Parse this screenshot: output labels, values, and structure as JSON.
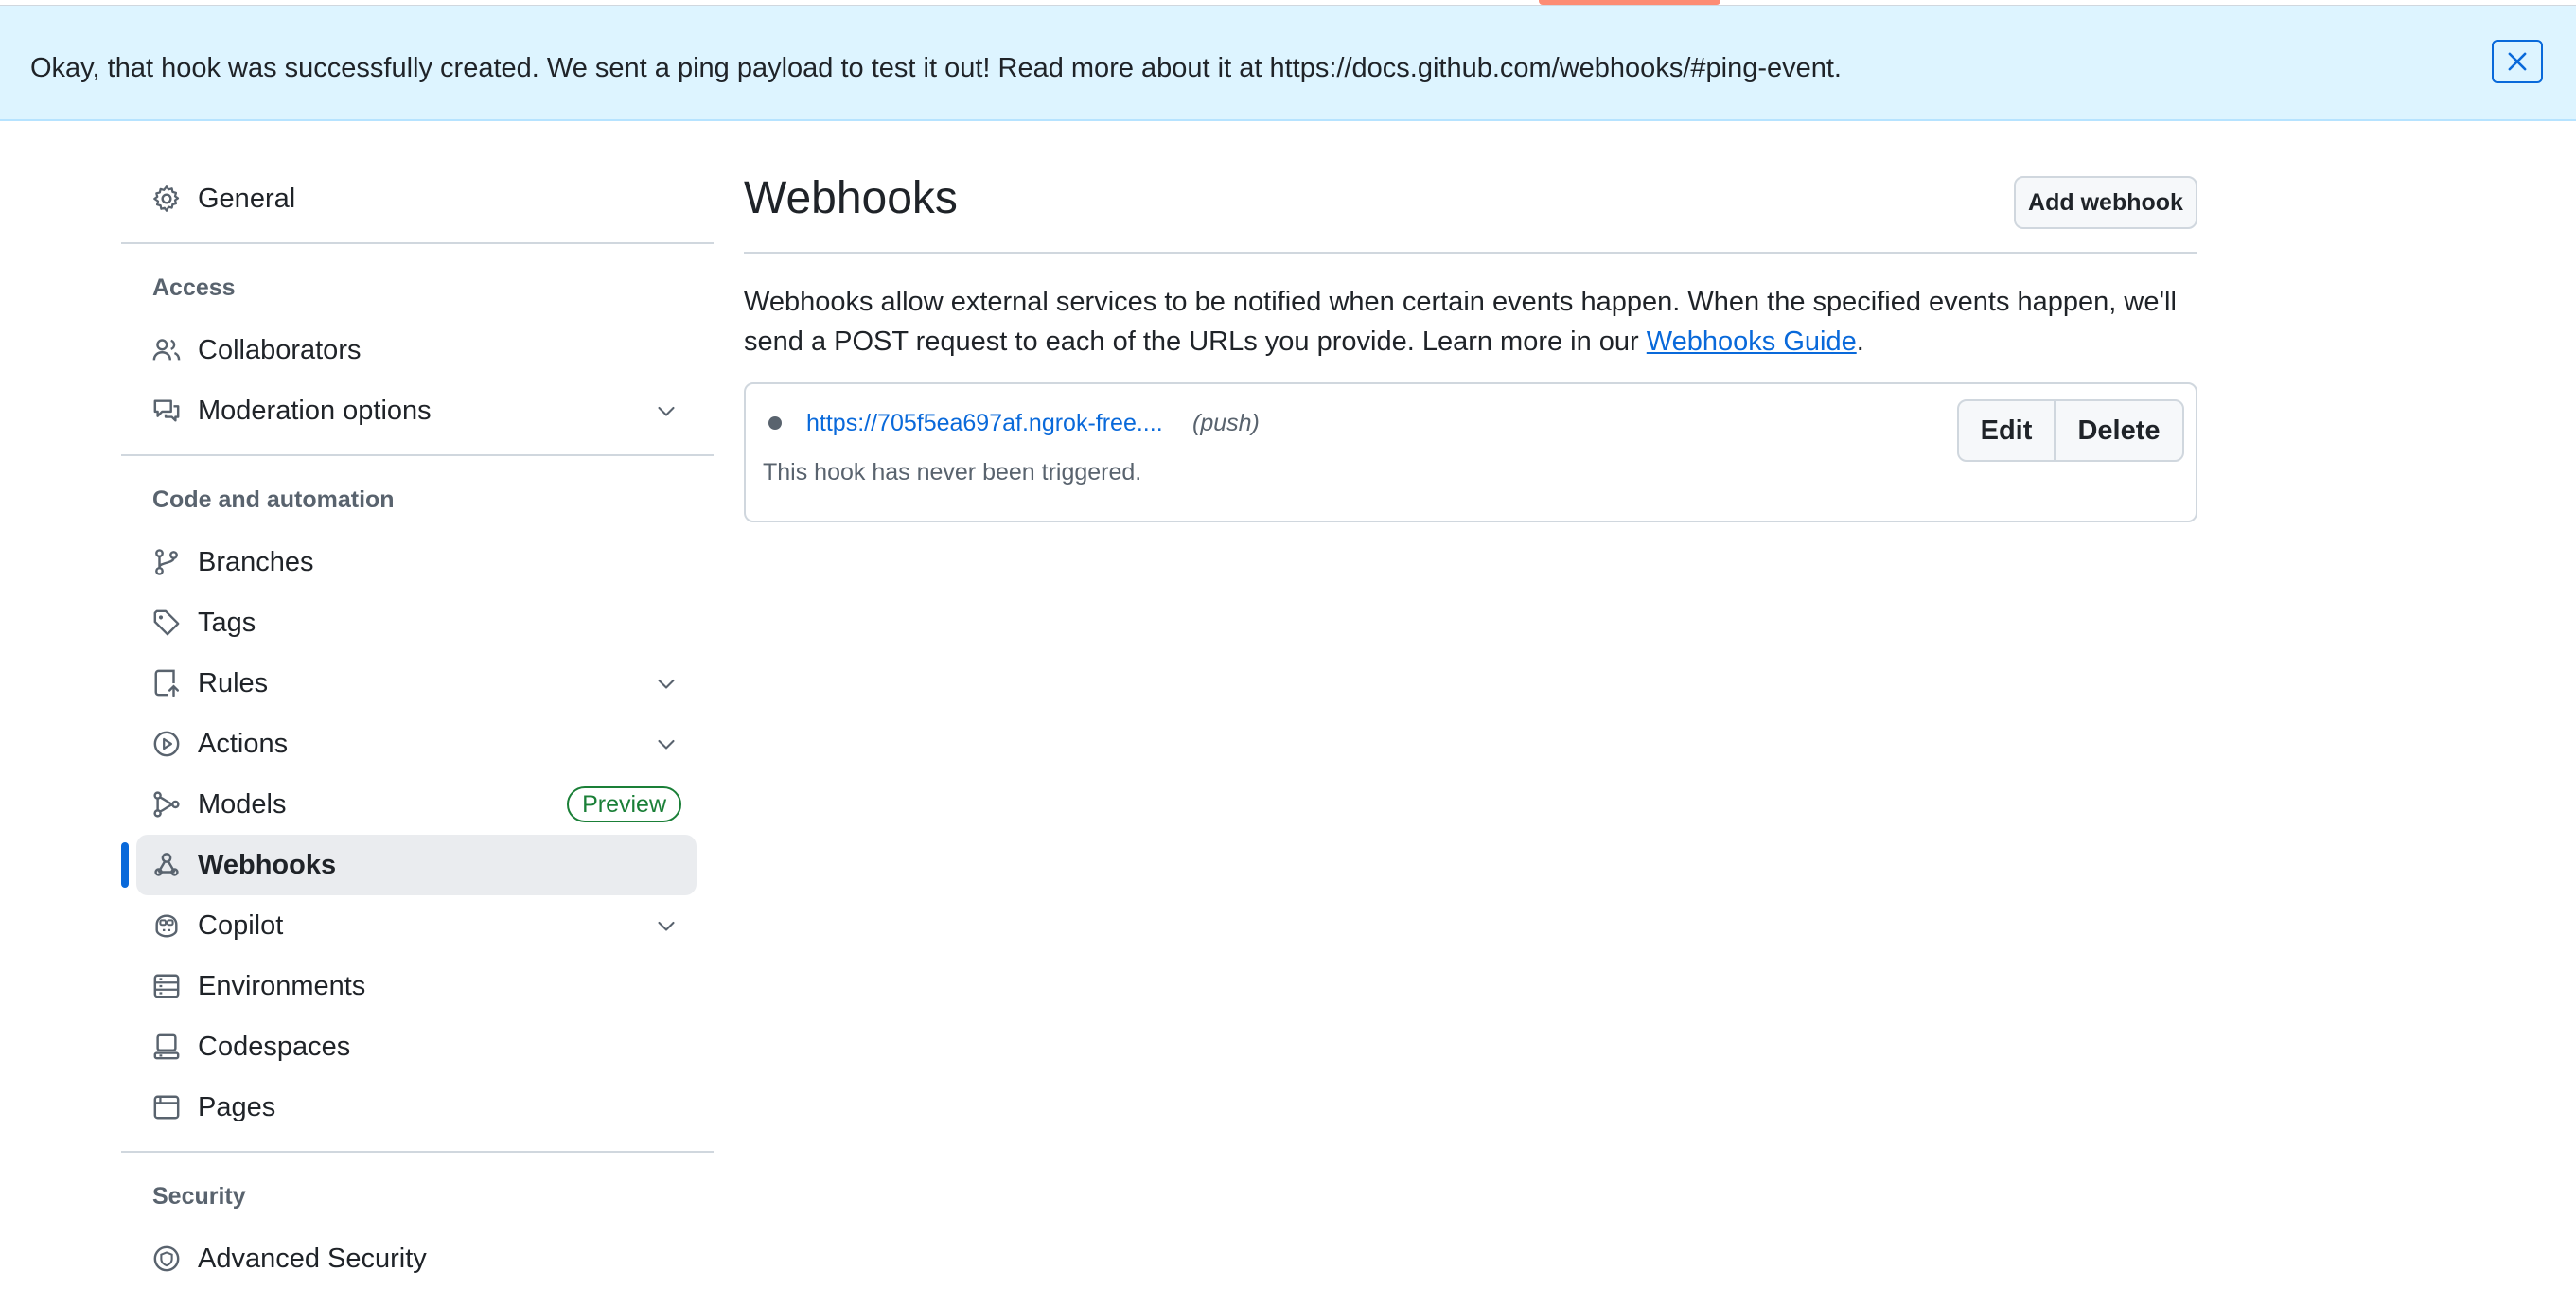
{
  "flash": {
    "message": "Okay, that hook was successfully created. We sent a ping payload to test it out! Read more about it at https://docs.github.com/webhooks/#ping-event."
  },
  "sidebar": {
    "general": "General",
    "sections": {
      "access": "Access",
      "code_automation": "Code and automation",
      "security": "Security"
    },
    "items": {
      "collaborators": "Collaborators",
      "moderation": "Moderation options",
      "branches": "Branches",
      "tags": "Tags",
      "rules": "Rules",
      "actions": "Actions",
      "models": "Models",
      "models_badge": "Preview",
      "webhooks": "Webhooks",
      "copilot": "Copilot",
      "environments": "Environments",
      "codespaces": "Codespaces",
      "pages": "Pages",
      "advanced_security": "Advanced Security"
    }
  },
  "main": {
    "title": "Webhooks",
    "add_button": "Add webhook",
    "description_prefix": "Webhooks allow external services to be notified when certain events happen. When the specified events happen, we'll send a POST request to each of the URLs you provide. Learn more in our ",
    "guide_link": "Webhooks Guide",
    "description_suffix": ".",
    "hook": {
      "url": "https://705f5ea697af.ngrok-free....",
      "events": "(push)",
      "status": "This hook has never been triggered.",
      "edit": "Edit",
      "delete": "Delete"
    }
  },
  "colors": {
    "accent": "#0969da",
    "flash_bg": "#ddf4ff",
    "badge_green": "#1a7f37",
    "active_bg": "#eaecef"
  }
}
